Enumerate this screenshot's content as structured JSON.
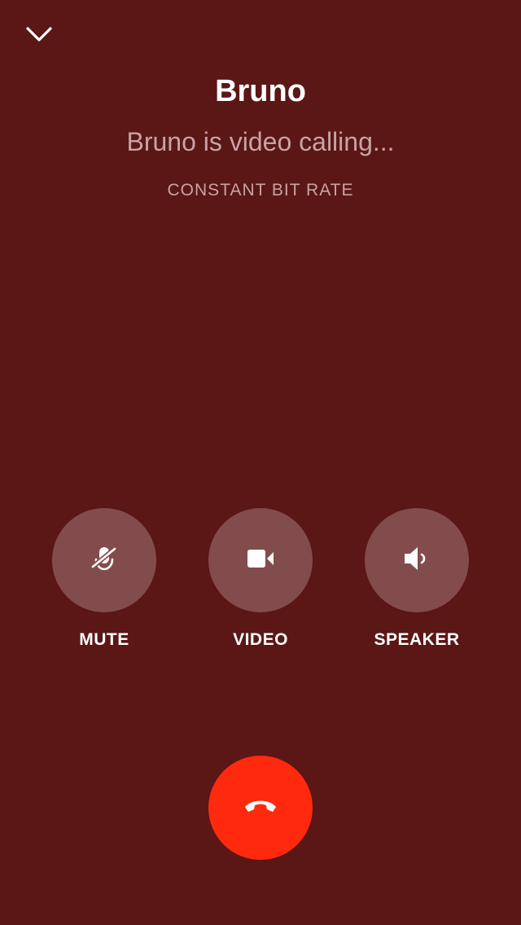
{
  "caller": {
    "name": "Bruno",
    "status": "Bruno is video calling...",
    "bitrate_label": "CONSTANT BIT RATE"
  },
  "controls": [
    {
      "label": "MUTE",
      "icon": "mic-off-icon"
    },
    {
      "label": "VIDEO",
      "icon": "video-camera-icon"
    },
    {
      "label": "SPEAKER",
      "icon": "speaker-icon"
    }
  ],
  "hangup": {
    "icon": "phone-hangup-icon",
    "color": "#ff2a0d"
  },
  "collapse": {
    "icon": "chevron-down-icon"
  },
  "colors": {
    "background": "#5b1616",
    "control_circle": "#834c4c",
    "secondary_text": "#c9a3a3"
  }
}
